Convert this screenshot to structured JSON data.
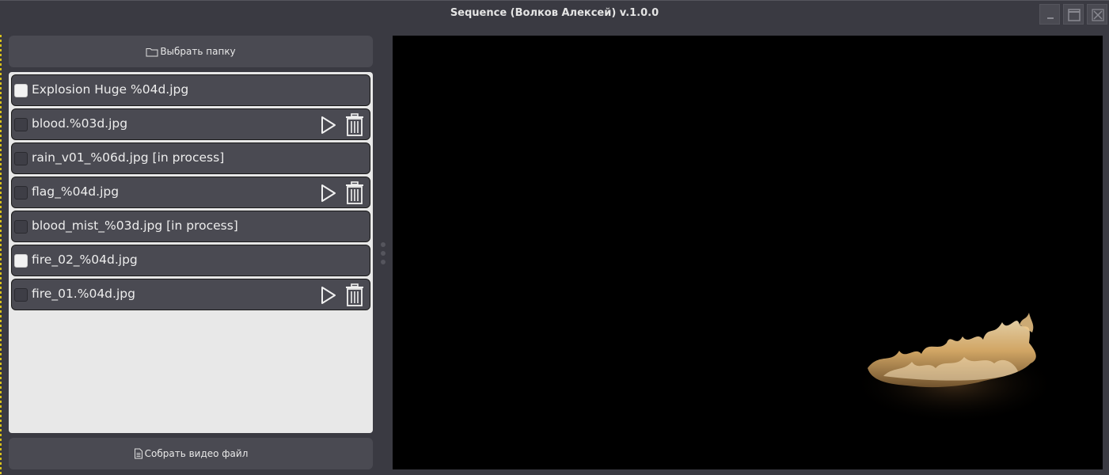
{
  "window": {
    "title": "Sequence (Волков Алексей) v.1.0.0"
  },
  "toolbar": {
    "choose_folder_label": "Выбрать папку",
    "build_video_label": "Собрать видео файл"
  },
  "sequences": [
    {
      "name": "Explosion Huge %04d.jpg",
      "checked_style": "light",
      "actions": false
    },
    {
      "name": "blood.%03d.jpg",
      "checked_style": "dark",
      "actions": true
    },
    {
      "name": "rain_v01_%06d.jpg [in process]",
      "checked_style": "dark",
      "actions": false
    },
    {
      "name": "flag_%04d.jpg",
      "checked_style": "dark",
      "actions": true
    },
    {
      "name": "blood_mist_%03d.jpg [in process]",
      "checked_style": "dark",
      "actions": false
    },
    {
      "name": "fire_02_%04d.jpg",
      "checked_style": "light",
      "actions": false
    },
    {
      "name": "fire_01.%04d.jpg",
      "checked_style": "dark",
      "actions": true
    }
  ],
  "icons": {
    "choose_folder": "folder-icon",
    "build_video": "document-icon",
    "play": "play-icon",
    "delete": "trash-icon",
    "minimize": "minimize-icon",
    "maximize": "maximize-icon",
    "close": "close-icon"
  },
  "colors": {
    "background": "#3a3a42",
    "button": "#4a4a52",
    "list_panel": "#e8e8e8",
    "preview": "#000000",
    "flame": "#e8b870"
  }
}
